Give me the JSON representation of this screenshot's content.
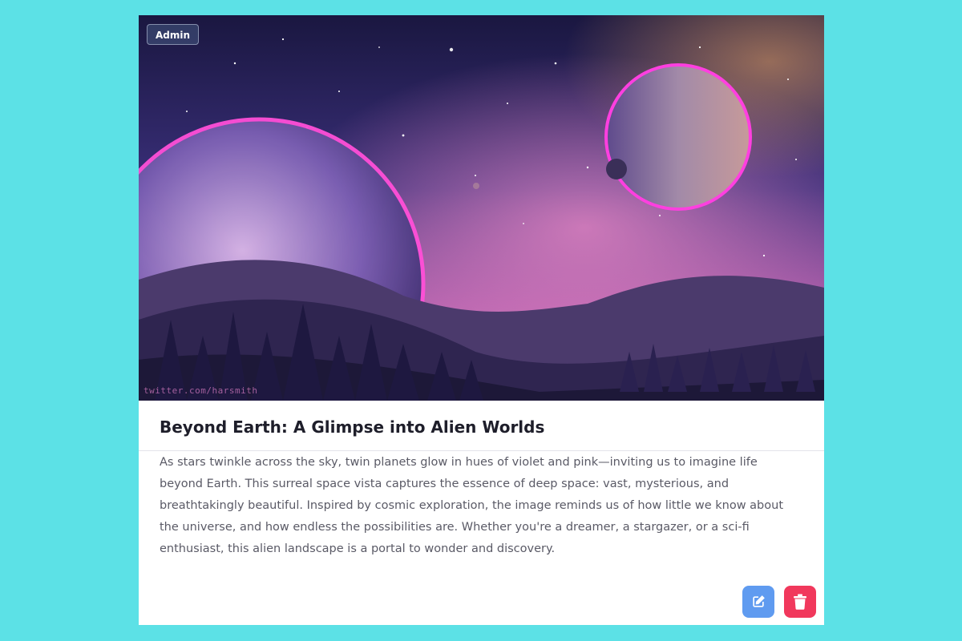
{
  "post": {
    "badge": "Admin",
    "image_watermark": "twitter.com/harsmith",
    "title": "Beyond Earth: A Glimpse into Alien Worlds",
    "description": "As stars twinkle across the sky, twin planets glow in hues of violet and pink—inviting us to imagine life beyond Earth. This surreal space vista captures the essence of deep space: vast, mysterious, and breathtakingly beautiful. Inspired by cosmic exploration, the image reminds us of how little we know about the universe, and how endless the possibilities are. Whether you're a dreamer, a stargazer, or a sci-fi enthusiast, this alien landscape is a portal to wonder and discovery."
  },
  "actions": {
    "edit_icon": "edit-icon",
    "delete_icon": "trash-icon"
  },
  "colors": {
    "page_background": "#5ce1e6",
    "card_background": "#ffffff",
    "edit_button": "#5f9bf0",
    "delete_button": "#f1385c"
  }
}
